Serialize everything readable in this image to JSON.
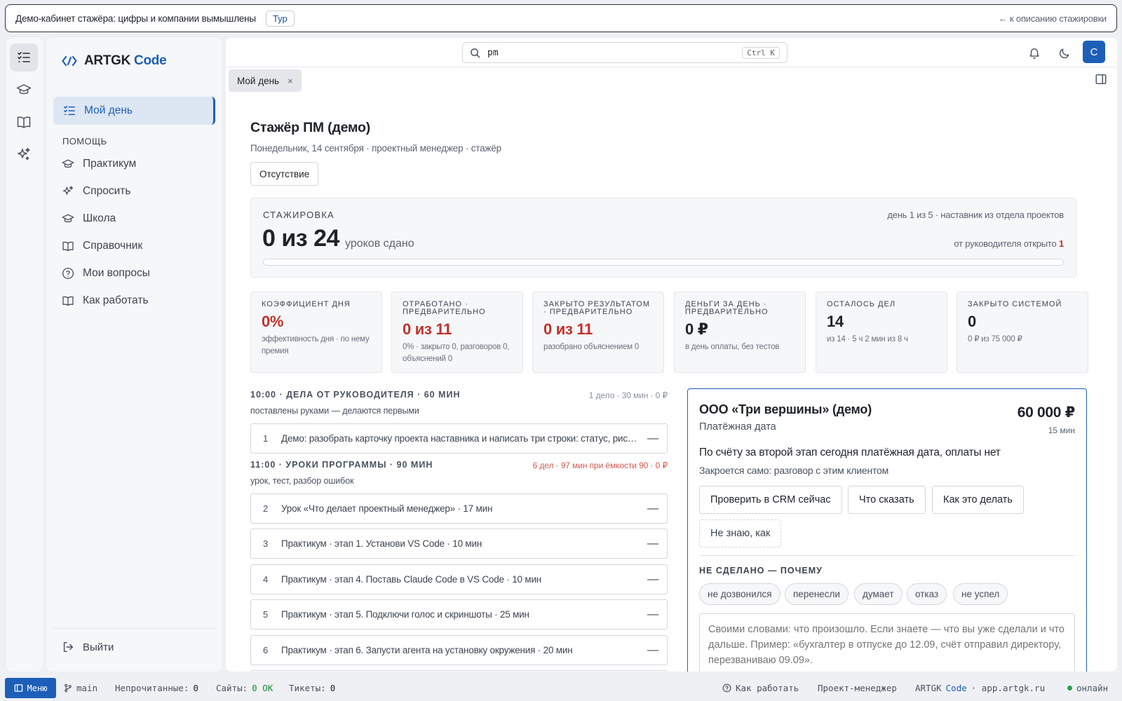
{
  "banner": {
    "text": "Демо-кабинет стажёра: цифры и компании вымышлены",
    "tour_label": "Тур",
    "back_link": "← к описанию стажировки"
  },
  "sidebar": {
    "logo_part1": "ARTGK",
    "logo_part2": "Code",
    "active_item": "Мой день",
    "section_label": "ПОМОЩЬ",
    "items": [
      {
        "label": "Практикум",
        "icon": "graduation-cap-icon"
      },
      {
        "label": "Спросить",
        "icon": "sparkles-icon"
      },
      {
        "label": "Школа",
        "icon": "graduation-cap-icon"
      },
      {
        "label": "Справочник",
        "icon": "book-icon"
      },
      {
        "label": "Мои вопросы",
        "icon": "question-circle-icon"
      },
      {
        "label": "Как работать",
        "icon": "book-icon"
      }
    ],
    "logout_label": "Выйти"
  },
  "topbar": {
    "search_value": "pm",
    "shortcut": "Ctrl K",
    "avatar_letter": "С"
  },
  "tab": {
    "label": "Мой день",
    "close": "×"
  },
  "page": {
    "title": "Стажёр ПМ (демо)",
    "subtitle": "Понедельник, 14 сентября · проектный менеджер · стажёр",
    "absence_button": "Отсутствие"
  },
  "internship": {
    "label": "СТАЖИРОВКА",
    "right_info": "день 1 из 5 · наставник из отдела проектов",
    "done_big": "0 из 24",
    "done_unit": "уроков сдано",
    "opened_prefix": "от руководителя открыто",
    "opened_count": "1",
    "progress_fraction": 0.0
  },
  "kpis": [
    {
      "label": "Коэффициент дня",
      "value": "0%",
      "note": "эффективность дня · по нему премия",
      "color": "red"
    },
    {
      "label": "Отработано · предварительно",
      "value": "0 из 11",
      "note": "0% · закрыто 0, разговоров 0, объяснений 0",
      "color": "red"
    },
    {
      "label": "Закрыто результатом · предварительно",
      "value": "0 из 11",
      "note": "разобрано объяснением 0",
      "color": "red"
    },
    {
      "label": "Деньги за день · предварительно",
      "value": "0 ₽",
      "note": "в день оплаты, без тестов",
      "color": "dark"
    },
    {
      "label": "Осталось дел",
      "value": "14",
      "note": "из 14 · 5 ч 2 мин из 8 ч",
      "color": "dark"
    },
    {
      "label": "Закрыто системой",
      "value": "0",
      "note": "0 ₽ из 75 000 ₽",
      "color": "dark"
    }
  ],
  "sections": [
    {
      "head": "10:00 · ДЕЛА ОТ РУКОВОДИТЕЛЯ · 60 МИН",
      "meta": "1 дело · 30 мин · 0 ₽",
      "sub": "поставлены руками — делаются первыми",
      "tasks": [
        {
          "num": "1",
          "text": "Демо: разобрать карточку проекта наставника и написать три строки: статус, риск, следующий шаг"
        }
      ]
    },
    {
      "head": "11:00 · УРОКИ ПРОГРАММЫ · 90 МИН",
      "meta": "6 дел · 97 мин при ёмкости 90 · 0 ₽",
      "sub": "урок, тест, разбор ошибок",
      "tasks": [
        {
          "num": "2",
          "text": "Урок «Что делает проектный менеджер» · 17 мин"
        },
        {
          "num": "3",
          "text": "Практикум · этап 1. Установи VS Code · 10 мин"
        },
        {
          "num": "4",
          "text": "Практикум · этап 4. Поставь Claude Code в VS Code · 10 мин"
        },
        {
          "num": "5",
          "text": "Практикум · этап 5. Подключи голос и скриншоты · 25 мин"
        },
        {
          "num": "6",
          "text": "Практикум · этап 6. Запусти агента на установку окружения · 20 мин"
        }
      ]
    }
  ],
  "client": {
    "name": "ООО «Три вершины» (демо)",
    "type": "Платёжная дата",
    "amount": "60 000 ₽",
    "duration": "15 мин",
    "message": "По счёту за второй этап сегодня платёжная дата, оплаты нет",
    "closes": "Закроется само: разговор с этим клиентом",
    "buttons": [
      "Проверить в CRM сейчас",
      "Что сказать",
      "Как это делать"
    ],
    "unknown_button": "Не знаю, как",
    "not_done_head": "НЕ СДЕЛАНО — ПОЧЕМУ",
    "reasons": [
      "не дозвонился",
      "перенесли",
      "думает",
      "отказ",
      "не успел"
    ],
    "note_placeholder": "Своими словами: что произошло. Если знаете — что вы уже сделали и что дальше. Пример: «бухгалтер в отпуске до 12.09, счёт отправил директору, перезваниваю 09.09»."
  },
  "statusbar": {
    "menu": "Меню",
    "branch": "main",
    "unread_label": "Непрочитанные:",
    "unread_value": "0",
    "sites_label": "Сайты:",
    "sites_value": "0 OK",
    "tickets_label": "Тикеты:",
    "tickets_value": "0",
    "how_to": "Как работать",
    "role": "Проект-менеджер",
    "brand1": "ARTGK",
    "brand2": "Code",
    "domain": "· app.artgk.ru",
    "online": "онлайн"
  }
}
